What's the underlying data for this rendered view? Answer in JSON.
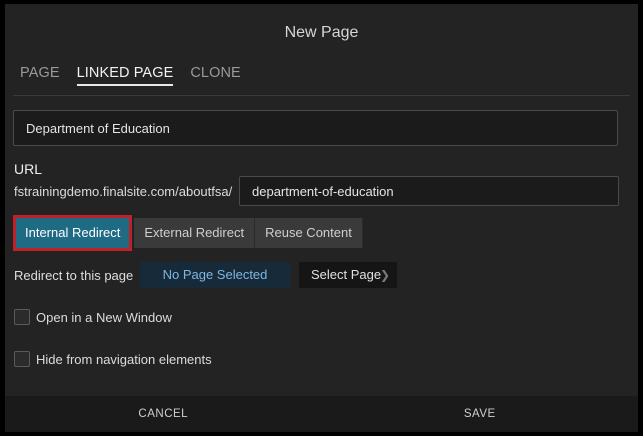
{
  "dialog": {
    "title": "New Page"
  },
  "tabs": [
    {
      "label": "PAGE",
      "active": false
    },
    {
      "label": "LINKED PAGE",
      "active": true
    },
    {
      "label": "CLONE",
      "active": false
    }
  ],
  "name_field": {
    "value": "Department of Education"
  },
  "url": {
    "label": "URL",
    "prefix": "fstrainingdemo.finalsite.com/aboutfsa/",
    "slug": "department-of-education"
  },
  "redirect_types": [
    {
      "label": "Internal Redirect",
      "active": true
    },
    {
      "label": "External Redirect",
      "active": false
    },
    {
      "label": "Reuse Content",
      "active": false
    }
  ],
  "redirect_target": {
    "label": "Redirect to this page",
    "status": "No Page Selected",
    "select_label": "Select Page",
    "select_icon": "chevron-right-icon"
  },
  "options": [
    {
      "label": "Open in a New Window",
      "checked": false
    },
    {
      "label": "Hide from navigation elements",
      "checked": false
    }
  ],
  "footer": {
    "cancel_label": "CANCEL",
    "save_label": "SAVE"
  },
  "colors": {
    "dialog_bg": "#232323",
    "accent_blue": "#1f6b84",
    "highlight_red": "#c0202a",
    "no_page_text": "#7fb7e0"
  }
}
